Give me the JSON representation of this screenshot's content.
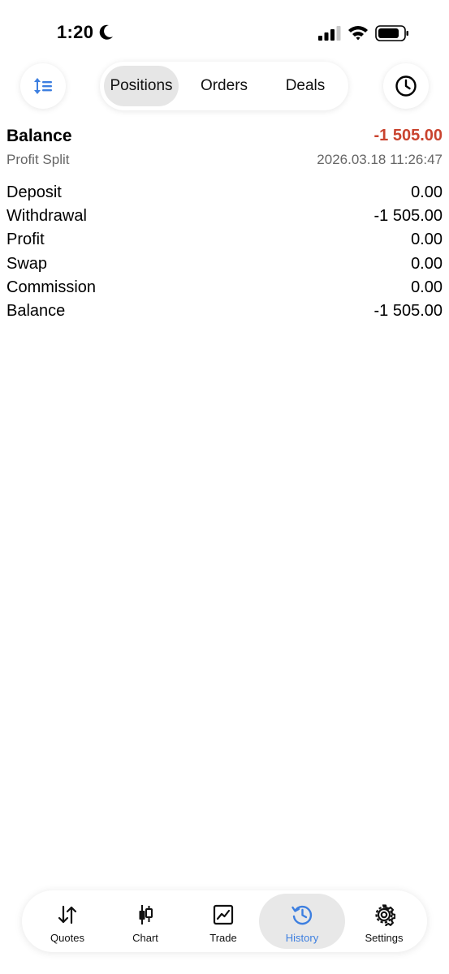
{
  "status_bar": {
    "time": "1:20"
  },
  "toolbar": {
    "segments": [
      "Positions",
      "Orders",
      "Deals"
    ],
    "active_segment": "Positions"
  },
  "record": {
    "title": "Balance",
    "amount": "-1 505.00",
    "amount_color": "#c9432e",
    "subtitle": "Profit Split",
    "datetime": "2026.03.18 11:26:47"
  },
  "details": [
    {
      "label": "Deposit",
      "value": "0.00"
    },
    {
      "label": "Withdrawal",
      "value": "-1 505.00"
    },
    {
      "label": "Profit",
      "value": "0.00"
    },
    {
      "label": "Swap",
      "value": "0.00"
    },
    {
      "label": "Commission",
      "value": "0.00"
    },
    {
      "label": "Balance",
      "value": "-1 505.00"
    }
  ],
  "tabbar": {
    "tabs": [
      {
        "label": "Quotes",
        "icon": "quotes-arrows-icon"
      },
      {
        "label": "Chart",
        "icon": "candlestick-icon"
      },
      {
        "label": "Trade",
        "icon": "trade-chart-icon"
      },
      {
        "label": "History",
        "icon": "history-clock-icon"
      },
      {
        "label": "Settings",
        "icon": "gear-icon"
      }
    ],
    "active_tab": "History",
    "accent_color": "#3d7fe0"
  }
}
